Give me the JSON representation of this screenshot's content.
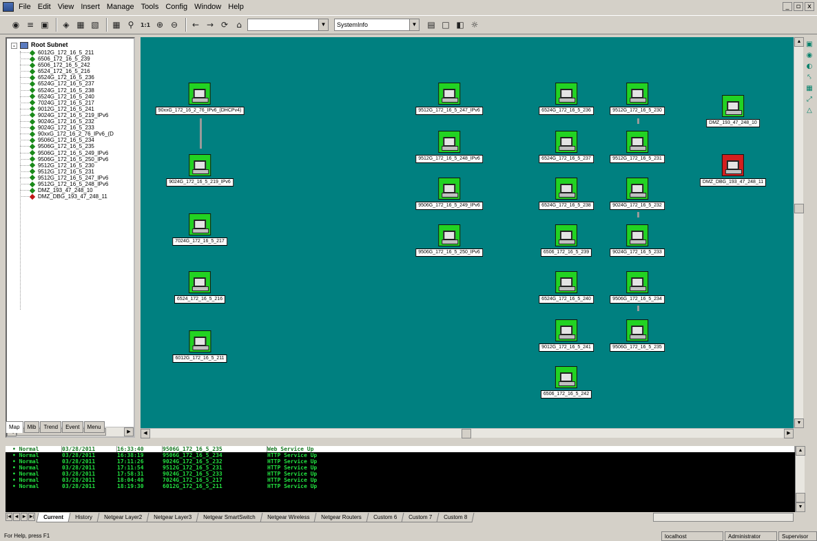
{
  "menu": [
    "File",
    "Edit",
    "View",
    "Insert",
    "Manage",
    "Tools",
    "Config",
    "Window",
    "Help"
  ],
  "window_controls": [
    "_",
    "▫",
    "x"
  ],
  "toolbar": {
    "combo1_value": "",
    "combo2_value": "SystemInfo"
  },
  "tree": {
    "root_label": "Root Subnet",
    "items": [
      {
        "label": "6012G_172_16_5_211",
        "status": "normal"
      },
      {
        "label": "6506_172_16_5_239",
        "status": "normal"
      },
      {
        "label": "6506_172_16_5_242",
        "status": "normal"
      },
      {
        "label": "6524_172_16_5_216",
        "status": "normal"
      },
      {
        "label": "6524G_172_16_5_236",
        "status": "normal"
      },
      {
        "label": "6524G_172_16_5_237",
        "status": "normal"
      },
      {
        "label": "6524G_172_16_5_238",
        "status": "normal"
      },
      {
        "label": "6524G_172_16_5_240",
        "status": "normal"
      },
      {
        "label": "7024G_172_16_5_217",
        "status": "normal"
      },
      {
        "label": "9012G_172_16_5_241",
        "status": "normal"
      },
      {
        "label": "9024G_172_16_5_219_IPv6",
        "status": "normal"
      },
      {
        "label": "9024G_172_16_5_232",
        "status": "normal"
      },
      {
        "label": "9024G_172_16_5_233",
        "status": "normal"
      },
      {
        "label": "90xxG_172_16_2_76_IPv6_(D",
        "status": "normal"
      },
      {
        "label": "9506G_172_16_5_234",
        "status": "normal"
      },
      {
        "label": "9506G_172_16_5_235",
        "status": "normal"
      },
      {
        "label": "9506G_172_16_5_249_IPv6",
        "status": "normal"
      },
      {
        "label": "9506G_172_16_5_250_IPv6",
        "status": "normal"
      },
      {
        "label": "9512G_172_16_5_230",
        "status": "normal"
      },
      {
        "label": "9512G_172_16_5_231",
        "status": "normal"
      },
      {
        "label": "9512G_172_16_5_247_IPv6",
        "status": "normal"
      },
      {
        "label": "9512G_172_16_5_248_IPv6",
        "status": "normal"
      },
      {
        "label": "DMZ_193_47_248_10",
        "status": "normal"
      },
      {
        "label": "DMZ_DBG_193_47_248_11",
        "status": "critical"
      }
    ]
  },
  "left_tabs": [
    "Map",
    "Mib",
    "Trend",
    "Event",
    "Menu"
  ],
  "map": {
    "nodes": [
      {
        "label": "90xxG_172_16_2_76_IPv6_(DHCPv4)",
        "status": "normal"
      },
      {
        "label": "9024G_172_16_5_219_IPv6",
        "status": "normal"
      },
      {
        "label": "7024G_172_16_5_217",
        "status": "normal"
      },
      {
        "label": "6524_172_16_5_216",
        "status": "normal"
      },
      {
        "label": "6012G_172_16_5_211",
        "status": "normal"
      },
      {
        "label": "9512G_172_16_5_247_IPv6",
        "status": "normal"
      },
      {
        "label": "9512G_172_16_5_248_IPv6",
        "status": "normal"
      },
      {
        "label": "9506G_172_16_5_249_IPv6",
        "status": "normal"
      },
      {
        "label": "9506G_172_16_5_250_IPv6",
        "status": "normal"
      },
      {
        "label": "6524G_172_16_5_236",
        "status": "normal"
      },
      {
        "label": "6524G_172_16_5_237",
        "status": "normal"
      },
      {
        "label": "6524G_172_16_5_238",
        "status": "normal"
      },
      {
        "label": "6506_172_16_5_239",
        "status": "normal"
      },
      {
        "label": "6524G_172_16_5_240",
        "status": "normal"
      },
      {
        "label": "9012G_172_16_5_241",
        "status": "normal"
      },
      {
        "label": "6506_172_16_5_242",
        "status": "normal"
      },
      {
        "label": "9512G_172_16_5_230",
        "status": "normal"
      },
      {
        "label": "9512G_172_16_5_231",
        "status": "normal"
      },
      {
        "label": "9024G_172_16_5_232",
        "status": "normal"
      },
      {
        "label": "9024G_172_16_5_233",
        "status": "normal"
      },
      {
        "label": "9506G_172_16_5_234",
        "status": "normal"
      },
      {
        "label": "9506G_172_16_5_235",
        "status": "normal"
      },
      {
        "label": "DMZ_193_47_248_10",
        "status": "normal"
      },
      {
        "label": "DMZ_DBG_193_47_248_11",
        "status": "critical"
      }
    ]
  },
  "log": {
    "rows": [
      {
        "status": "Normal",
        "date": "03/28/2011",
        "time": "16:33:40",
        "device": "9506G_172_16_5_235",
        "message": "Web Service Up"
      },
      {
        "status": "Normal",
        "date": "03/28/2011",
        "time": "16:38:19",
        "device": "9506G_172_16_5_234",
        "message": "HTTP Service Up"
      },
      {
        "status": "Normal",
        "date": "03/28/2011",
        "time": "17:11:26",
        "device": "9024G_172_16_5_232",
        "message": "HTTP Service Up"
      },
      {
        "status": "Normal",
        "date": "03/28/2011",
        "time": "17:11:54",
        "device": "9512G_172_16_5_231",
        "message": "HTTP Service Up"
      },
      {
        "status": "Normal",
        "date": "03/28/2011",
        "time": "17:58:31",
        "device": "9024G_172_16_5_233",
        "message": "HTTP Service Up"
      },
      {
        "status": "Normal",
        "date": "03/28/2011",
        "time": "18:04:40",
        "device": "7024G_172_16_5_217",
        "message": "HTTP Service Up"
      },
      {
        "status": "Normal",
        "date": "03/28/2011",
        "time": "18:19:30",
        "device": "6012G_172_16_5_211",
        "message": "HTTP Service Up"
      }
    ]
  },
  "bottom_tabs": [
    "Current",
    "History",
    "Netgear Layer2",
    "Netgear Layer3",
    "Netgear SmartSwitch",
    "Netgear Wireless",
    "Netgear Routers",
    "Custom 6",
    "Custom 7",
    "Custom 8"
  ],
  "status": {
    "help": "For Help, press F1",
    "host": "localhost",
    "user": "Administrator",
    "role": "Supervisor"
  },
  "colors": {
    "map_bg": "#008080",
    "node_normal": "#22d322",
    "node_critical": "#d41e1e",
    "tree_normal": "#1a8a1a",
    "tree_critical": "#c01818",
    "log_text": "#22e040"
  },
  "icons": [
    "binoculars-icon",
    "open-icon",
    "save-icon",
    "zoom-icon",
    "refresh-icon",
    "arrow-left-icon",
    "arrow-right-icon",
    "home-icon",
    "grid-icon",
    "sun-icon"
  ]
}
